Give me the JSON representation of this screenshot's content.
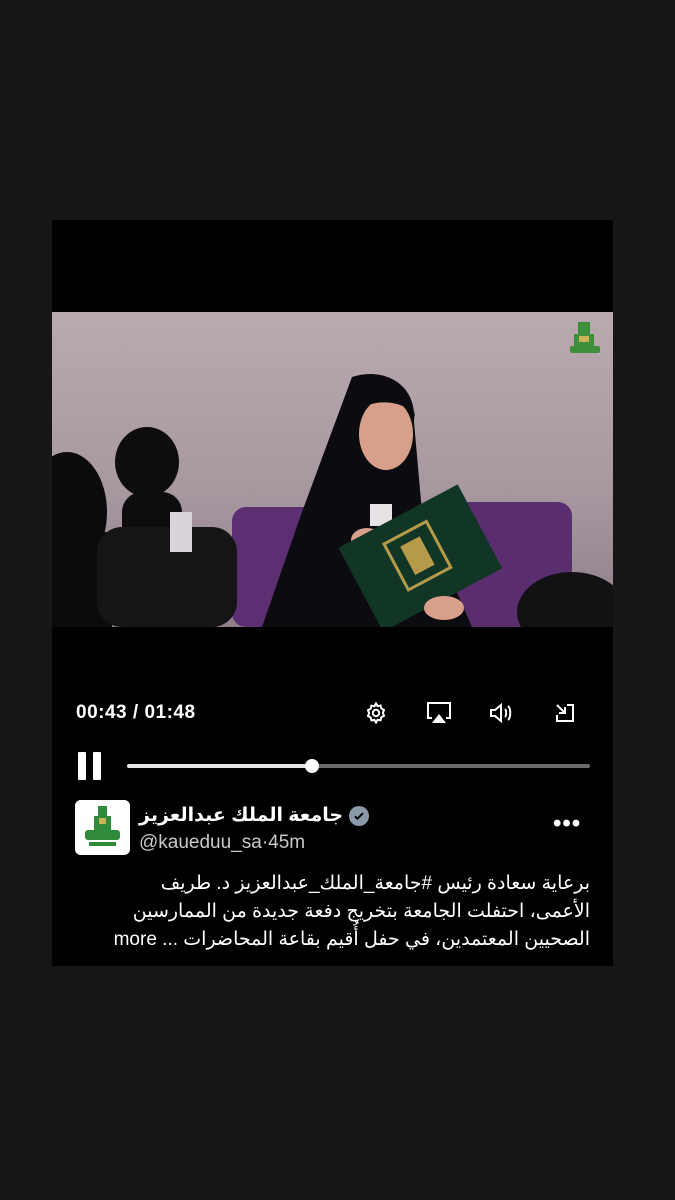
{
  "player": {
    "current_time": "00:43",
    "separator": "/",
    "duration": "01:48",
    "progress_fraction": 0.4,
    "icons": [
      "settings-icon",
      "airplay-icon",
      "volume-icon",
      "exit-fullscreen-icon",
      "pause-icon"
    ]
  },
  "tweet": {
    "display_name": "جامعة الملك عبدالعزيز",
    "handle": "@kaueduu_sa",
    "time_ago": "45m",
    "text_lines": [
      "برعاية سعادة رئيس #جامعة_الملك_عبدالعزيز  د. طريف",
      "الأعمى، احتفلت الجامعة بتخريج دفعة جديدة من الممارسين",
      "الصحيين المعتمدين، في حفل أُقيم بقاعة المحاضرات ..."
    ],
    "more_label": "more",
    "menu_label": "•••"
  },
  "colors": {
    "background": "#161616",
    "card": "#000000",
    "verified_badge": "#8a9aa8",
    "progress_track": "#6b6b6b"
  }
}
